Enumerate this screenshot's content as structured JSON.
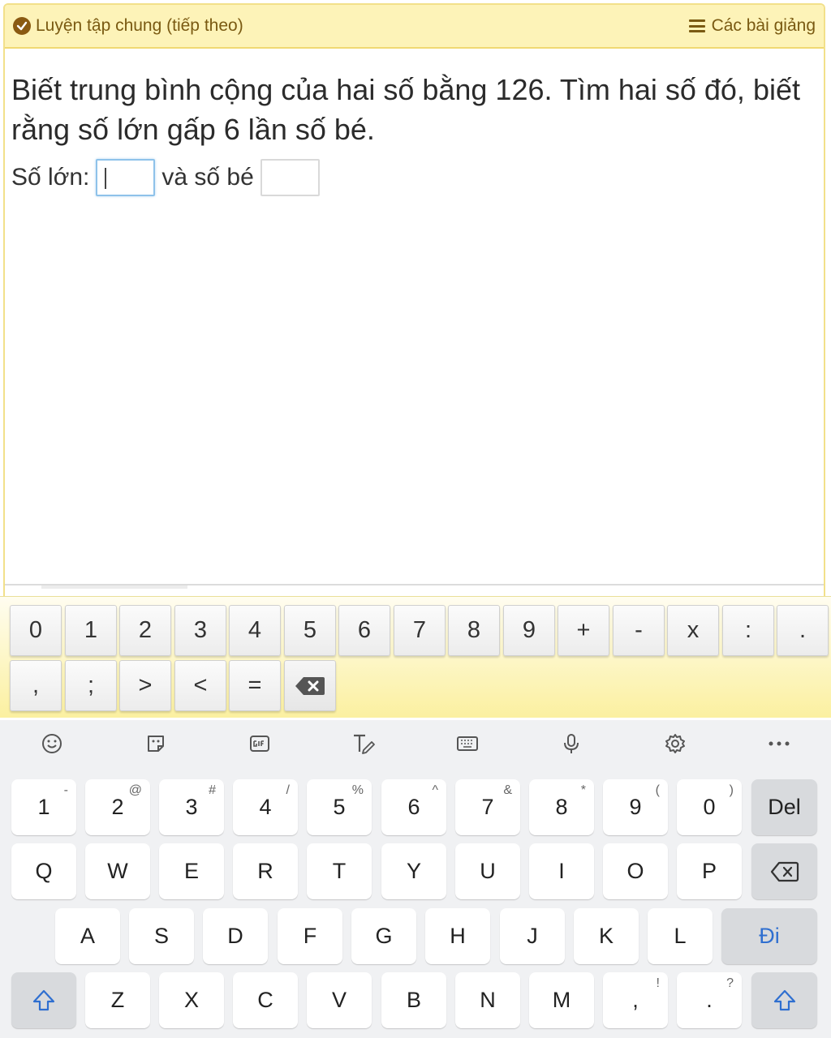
{
  "header": {
    "title": "Luyện tập chung (tiếp theo)",
    "lessons_label": "Các bài giảng"
  },
  "question": {
    "text": "Biết trung bình cộng của hai số bằng 126. Tìm hai số đó, biết rằng số lớn gấp 6 lần số bé.",
    "large_label": "Số lớn:",
    "small_label": "và số bé",
    "large_value": "",
    "small_value": ""
  },
  "math_keypad": {
    "row1": [
      "0",
      "1",
      "2",
      "3",
      "4",
      "5",
      "6",
      "7",
      "8",
      "9",
      "+",
      "-",
      "x",
      ":",
      "."
    ],
    "row2": [
      ",",
      ";",
      ">",
      "<",
      "="
    ]
  },
  "keyboard": {
    "number_row": [
      {
        "key": "1",
        "alt": "-"
      },
      {
        "key": "2",
        "alt": "@"
      },
      {
        "key": "3",
        "alt": "#"
      },
      {
        "key": "4",
        "alt": "/"
      },
      {
        "key": "5",
        "alt": "%"
      },
      {
        "key": "6",
        "alt": "^"
      },
      {
        "key": "7",
        "alt": "&"
      },
      {
        "key": "8",
        "alt": "*"
      },
      {
        "key": "9",
        "alt": "("
      },
      {
        "key": "0",
        "alt": ")"
      }
    ],
    "del_label": "Del",
    "row_q": [
      "Q",
      "W",
      "E",
      "R",
      "T",
      "Y",
      "U",
      "I",
      "O",
      "P"
    ],
    "row_a": [
      "A",
      "S",
      "D",
      "F",
      "G",
      "H",
      "J",
      "K",
      "L"
    ],
    "go_label": "Đi",
    "row_z": [
      "Z",
      "X",
      "C",
      "V",
      "B",
      "N",
      "M"
    ],
    "comma": {
      "key": ",",
      "alt": "!"
    },
    "period": {
      "key": ".",
      "alt": "?"
    }
  }
}
